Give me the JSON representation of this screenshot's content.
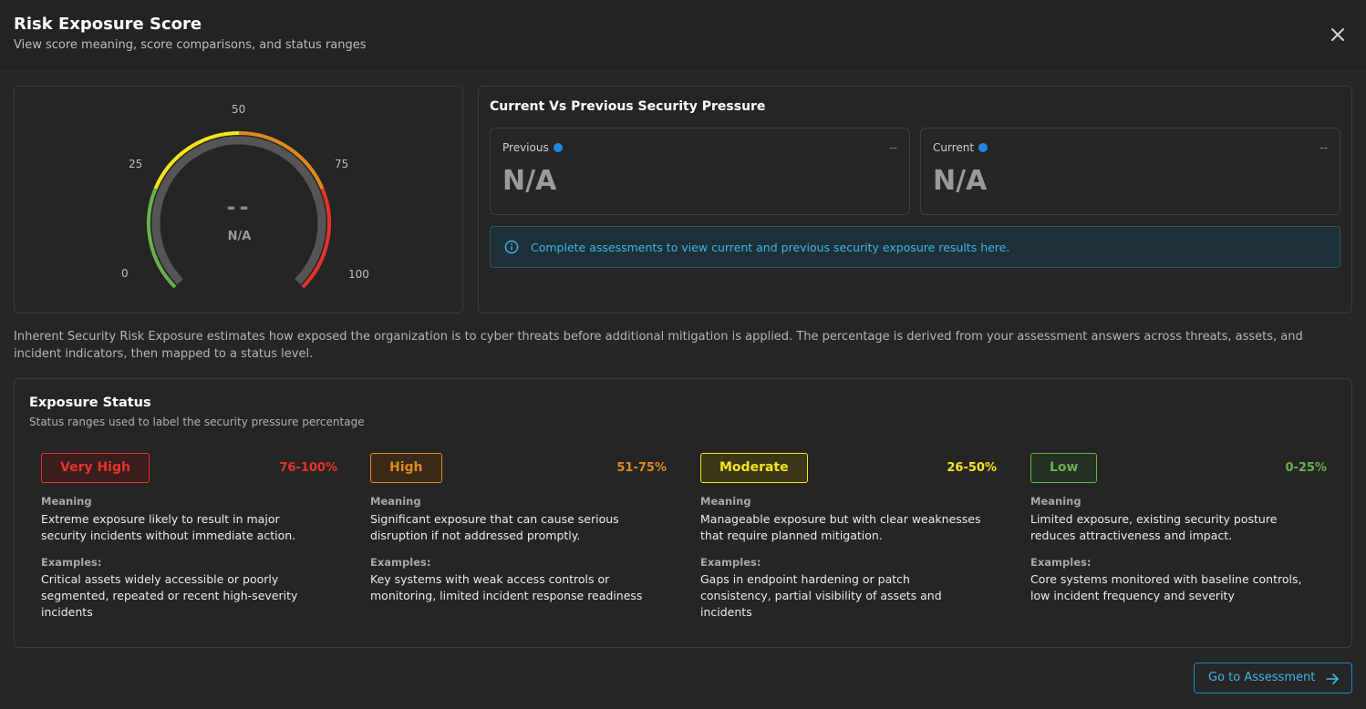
{
  "header": {
    "title": "Risk Exposure Score",
    "subtitle": "View score meaning, score comparisons, and status ranges"
  },
  "gauge": {
    "ticks": {
      "t0": "0",
      "t25": "25",
      "t50": "50",
      "t75": "75",
      "t100": "100"
    },
    "value": "--",
    "label": "N/A",
    "colors": {
      "low": "#6ab04c",
      "moderate": "#f5e61a",
      "high": "#e08a1e",
      "very_high": "#e8322b",
      "track": "#555555"
    }
  },
  "pressure": {
    "title": "Current Vs Previous Security Pressure",
    "previous": {
      "label": "Previous",
      "delta": "--",
      "value": "N/A"
    },
    "current": {
      "label": "Current",
      "delta": "--",
      "value": "N/A"
    },
    "banner": "Complete assessments to view current and previous security exposure results here."
  },
  "description": "Inherent Security Risk Exposure estimates how exposed the organization is to cyber threats before additional mitigation is applied. The percentage is derived from your assessment answers across threats, assets, and incident indicators, then mapped to a status level.",
  "status": {
    "title": "Exposure Status",
    "subtitle": "Status ranges used to label the security pressure percentage",
    "meaning_label": "Meaning",
    "examples_label": "Examples:",
    "levels": [
      {
        "name": "Very High",
        "range": "76-100%",
        "color": "#e8322b",
        "meaning": "Extreme exposure likely to result in major security incidents without immediate action.",
        "examples": "Critical assets widely accessible or poorly segmented, repeated or recent high-severity incidents"
      },
      {
        "name": "High",
        "range": "51-75%",
        "color": "#e08a1e",
        "meaning": "Significant exposure that can cause serious disruption if not addressed promptly.",
        "examples": "Key systems with weak access controls or monitoring, limited incident response readiness"
      },
      {
        "name": "Moderate",
        "range": "26-50%",
        "color": "#f5e61a",
        "meaning": "Manageable exposure but with clear weaknesses that require planned mitigation.",
        "examples": "Gaps in endpoint hardening or patch consistency, partial visibility of assets and incidents"
      },
      {
        "name": "Low",
        "range": "0-25%",
        "color": "#6ab04c",
        "meaning": "Limited exposure, existing security posture reduces attractiveness and impact.",
        "examples": "Core systems monitored with baseline controls, low incident frequency and severity"
      }
    ]
  },
  "footer": {
    "go_label": "Go to Assessment"
  }
}
